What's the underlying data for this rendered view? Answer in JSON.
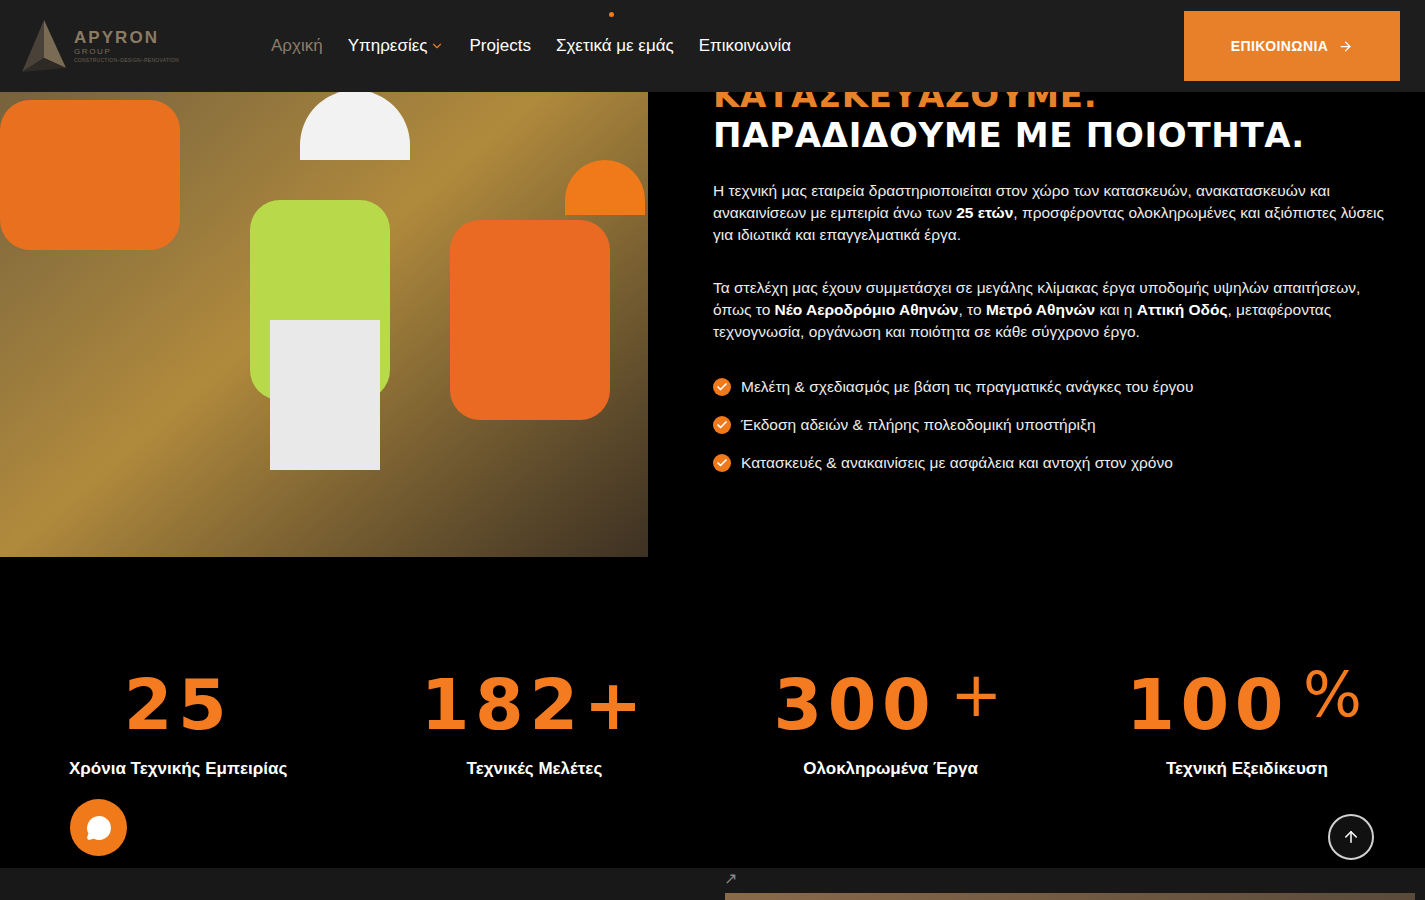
{
  "header": {
    "logo": {
      "name": "APYRON",
      "sub": "GROUP",
      "tagline": "CONSTRUCTION–DESIGN–RENOVATION"
    },
    "nav": [
      {
        "label": "Αρχική",
        "selected": true,
        "dropdown": false,
        "marker": false
      },
      {
        "label": "Υπηρεσίες",
        "selected": false,
        "dropdown": true,
        "marker": false
      },
      {
        "label": "Projects",
        "selected": false,
        "dropdown": false,
        "marker": false
      },
      {
        "label": "Σχετικά με εμάς",
        "selected": false,
        "dropdown": false,
        "marker": true
      },
      {
        "label": "Επικοινωνία",
        "selected": false,
        "dropdown": false,
        "marker": false
      }
    ],
    "cta": "ΕΠΙΚΟΙΝΩΝΙΑ"
  },
  "about": {
    "heading_top": "ΚΑΤΑΣΚΕΥΑΖΟΥΜΕ.",
    "heading": "ΠΑΡΑΔΙΔΟΥΜΕ ΜΕ ΠΟΙΟΤΗΤΑ.",
    "paragraphs": [
      [
        {
          "text": "Η τεχνική μας εταιρεία δραστηριοποιείται στον χώρο των κατασκευών, ανακατασκευών και ανακαινίσεων με εμπειρία άνω των ",
          "bold": false
        },
        {
          "text": "25 ετών",
          "bold": true
        },
        {
          "text": ", προσφέροντας ολοκληρωμένες και αξιόπιστες λύσεις για ιδιωτικά και επαγγελματικά έργα.",
          "bold": false
        }
      ],
      [
        {
          "text": "Τα στελέχη μας έχουν συμμετάσχει σε μεγάλης κλίμακας έργα υποδομής υψηλών απαιτήσεων, όπως το ",
          "bold": false
        },
        {
          "text": "Νέο Αεροδρόμιο Αθηνών",
          "bold": true
        },
        {
          "text": ", το ",
          "bold": false
        },
        {
          "text": "Μετρό Αθηνών",
          "bold": true
        },
        {
          "text": " και η ",
          "bold": false
        },
        {
          "text": "Αττική Οδός",
          "bold": true
        },
        {
          "text": ", μεταφέροντας τεχνογνωσία, οργάνωση και ποιότητα σε κάθε σύγχρονο έργο.",
          "bold": false
        }
      ]
    ],
    "checklist": [
      "Μελέτη & σχεδιασμός με βάση τις πραγματικές ανάγκες του έργου",
      "Έκδοση αδειών & πλήρης πολεοδομική υποστήριξη",
      "Κατασκευές & ανακαινίσεις με ασφάλεια και αντοχή στον χρόνο"
    ]
  },
  "stats": [
    {
      "value": "25",
      "label": "Χρόνια Τεχνικής Εμπειρίας"
    },
    {
      "value": "182",
      "suffix": "+",
      "raised": false,
      "label": "Τεχνικές Μελέτες"
    },
    {
      "value": "300",
      "suffix": "+",
      "raised": true,
      "label": "Ολοκληρωμένα Έργα"
    },
    {
      "value": "100",
      "suffix": "%",
      "raised": true,
      "label": "Τεχνική Εξειδίκευση"
    }
  ],
  "next_section": {
    "arrow": "↗"
  }
}
